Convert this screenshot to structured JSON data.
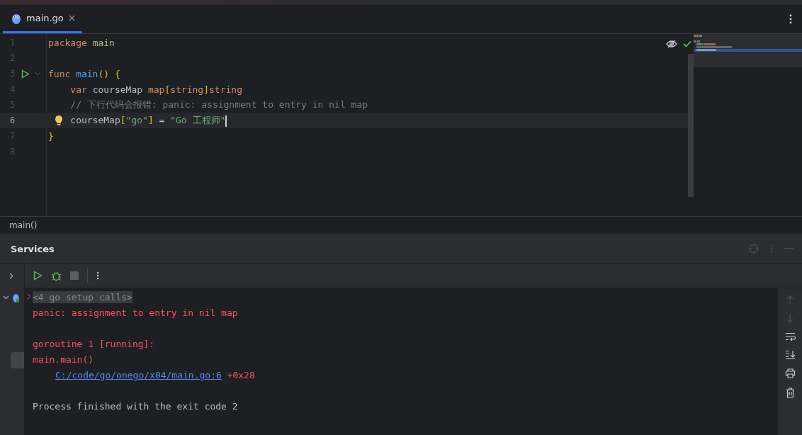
{
  "tabs": [
    {
      "label": "main.go",
      "selected": true
    }
  ],
  "code_lines": [
    {
      "number": "1",
      "current": false,
      "run": false,
      "tokens": [
        {
          "text": "package ",
          "kind": "keyword"
        },
        {
          "text": "main",
          "kind": "package"
        }
      ]
    },
    {
      "number": "2",
      "current": false,
      "run": false
    },
    {
      "number": "3",
      "current": false,
      "run": true,
      "tokens": [
        {
          "text": "func ",
          "kind": "keyword"
        },
        {
          "text": "main",
          "kind": "function"
        },
        {
          "text": "() {",
          "kind": "bracket"
        }
      ]
    },
    {
      "number": "4",
      "current": false,
      "run": false,
      "tokens": [
        {
          "text": "    var ",
          "kind": "keyword"
        },
        {
          "text": "courseMap ",
          "kind": "plain"
        },
        {
          "text": "map",
          "kind": "keyword"
        },
        {
          "text": "[",
          "kind": "bracket"
        },
        {
          "text": "string",
          "kind": "keyword"
        },
        {
          "text": "]",
          "kind": "bracket"
        },
        {
          "text": "string",
          "kind": "keyword"
        }
      ]
    },
    {
      "number": "5",
      "current": false,
      "run": false,
      "tokens": [
        {
          "text": "    // 下行代码会报错: panic: assignment to entry in nil map",
          "kind": "comment"
        }
      ]
    },
    {
      "number": "6",
      "current": true,
      "run": false,
      "tokens": [
        {
          "text": "    courseMap",
          "kind": "plain"
        },
        {
          "text": "[",
          "kind": "bracket"
        },
        {
          "text": "\"go\"",
          "kind": "string"
        },
        {
          "text": "]",
          "kind": "bracket"
        },
        {
          "text": " = ",
          "kind": "plain"
        },
        {
          "text": "\"Go 工程师\"",
          "kind": "string"
        }
      ]
    },
    {
      "number": "7",
      "current": false,
      "run": false,
      "tokens": [
        {
          "text": "}",
          "kind": "bracket"
        }
      ]
    },
    {
      "number": "8",
      "current": false,
      "run": false
    }
  ],
  "breadcrumb": "main()",
  "services": {
    "title": "Services"
  },
  "console_lines": [
    {
      "segments": [
        {
          "text": "<4 go setup calls>",
          "kind": "folded"
        }
      ]
    },
    {
      "segments": [
        {
          "text": "panic: assignment to entry in nil map",
          "kind": "error"
        }
      ]
    },
    {
      "blank_before": true,
      "segments": [
        {
          "text": "goroutine 1 [running]:",
          "kind": "error"
        }
      ]
    },
    {
      "segments": [
        {
          "text": "main.main()",
          "kind": "error"
        }
      ]
    },
    {
      "segments": [
        {
          "text": "C:/code/go/onego/x04/main.go:6",
          "kind": "link"
        },
        {
          "text": " +0x28",
          "kind": "error"
        }
      ]
    },
    {
      "blank_before": true,
      "segments": [
        {
          "text": "Process finished with the exit code 2",
          "kind": "plain"
        }
      ]
    }
  ]
}
